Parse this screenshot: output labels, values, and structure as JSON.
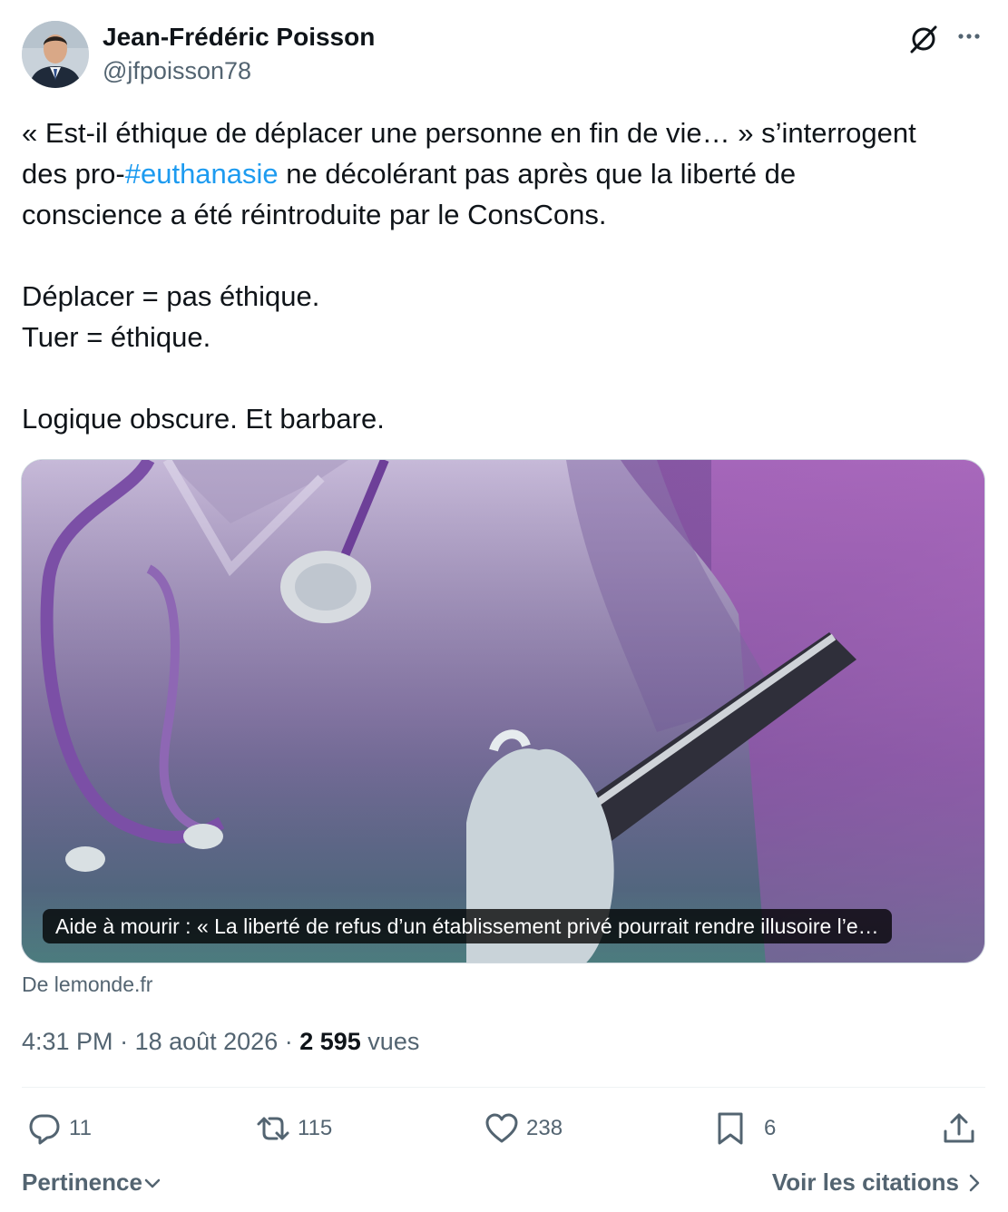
{
  "author": {
    "name": "Jean-Frédéric Poisson",
    "handle": "@jfpoisson78"
  },
  "icons": {
    "grok": "grok-slash-circle-icon",
    "more": "more-horizontal-icon",
    "reply": "reply-bubble-icon",
    "retweet": "retweet-icon",
    "like": "heart-icon",
    "bookmark": "bookmark-icon",
    "share": "share-upload-icon",
    "chevron_down": "chevron-down-icon",
    "chevron_right": "chevron-right-icon"
  },
  "tweet": {
    "line1": "« Est-il éthique de déplacer une personne en fin de vie… » s’interrogent",
    "line2_prefix": "des pro-",
    "hashtag": "#euthanasie",
    "line2_suffix": " ne décolérant pas après que la liberté de",
    "line3": "conscience a été réintroduite par le ConsCons.",
    "line4": "Déplacer = pas éthique.",
    "line5": "Tuer = éthique.",
    "line6": "Logique obscure. Et barbare."
  },
  "card": {
    "caption": "Aide à mourir : « La liberté de refus d’un établissement privé pourrait rendre illusoire l’e…",
    "source": "De lemonde.fr"
  },
  "meta": {
    "time": "4:31 PM",
    "separator": " · ",
    "date": "18 août 2026",
    "views_count": "2 595",
    "views_label": " vues"
  },
  "actions": {
    "replies": "11",
    "retweets": "115",
    "likes": "238",
    "bookmarks": "6"
  },
  "footer": {
    "sort_label": "Pertinence",
    "quotes_label": "Voir les citations"
  },
  "colors": {
    "link": "#1d9bf0",
    "text": "#0f1419",
    "secondary": "#536471",
    "card_purple": "#c77fd6",
    "card_teal": "#6fa6a0"
  }
}
